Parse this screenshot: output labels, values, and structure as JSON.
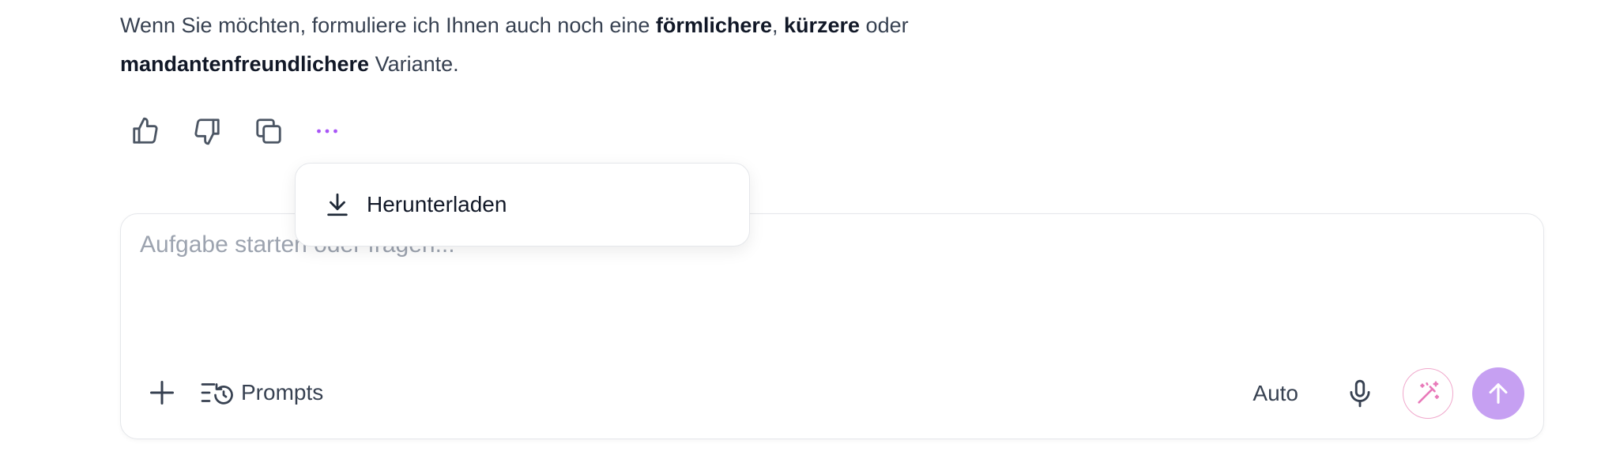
{
  "message": {
    "part1": "Wenn Sie möchten, formuliere ich Ihnen auch noch eine ",
    "bold1": "förmlichere",
    "sep1": ", ",
    "bold2": "kürzere",
    "part2": " oder",
    "bold3": "mandantenfreundlichere",
    "part3": " Variante."
  },
  "actions": {
    "thumbs_up": "thumbs-up-icon",
    "thumbs_down": "thumbs-down-icon",
    "copy": "copy-icon",
    "more": "more-horizontal-icon",
    "more_color": "#a855f7"
  },
  "dropdown": {
    "items": [
      {
        "label": "Herunterladen",
        "icon": "download-icon"
      }
    ]
  },
  "composer": {
    "placeholder": "Aufgabe starten oder fragen...",
    "value": "",
    "prompts_label": "Prompts",
    "mode_label": "Auto",
    "send_color": "#c6a0f2",
    "magic_color": "#e879b9"
  }
}
